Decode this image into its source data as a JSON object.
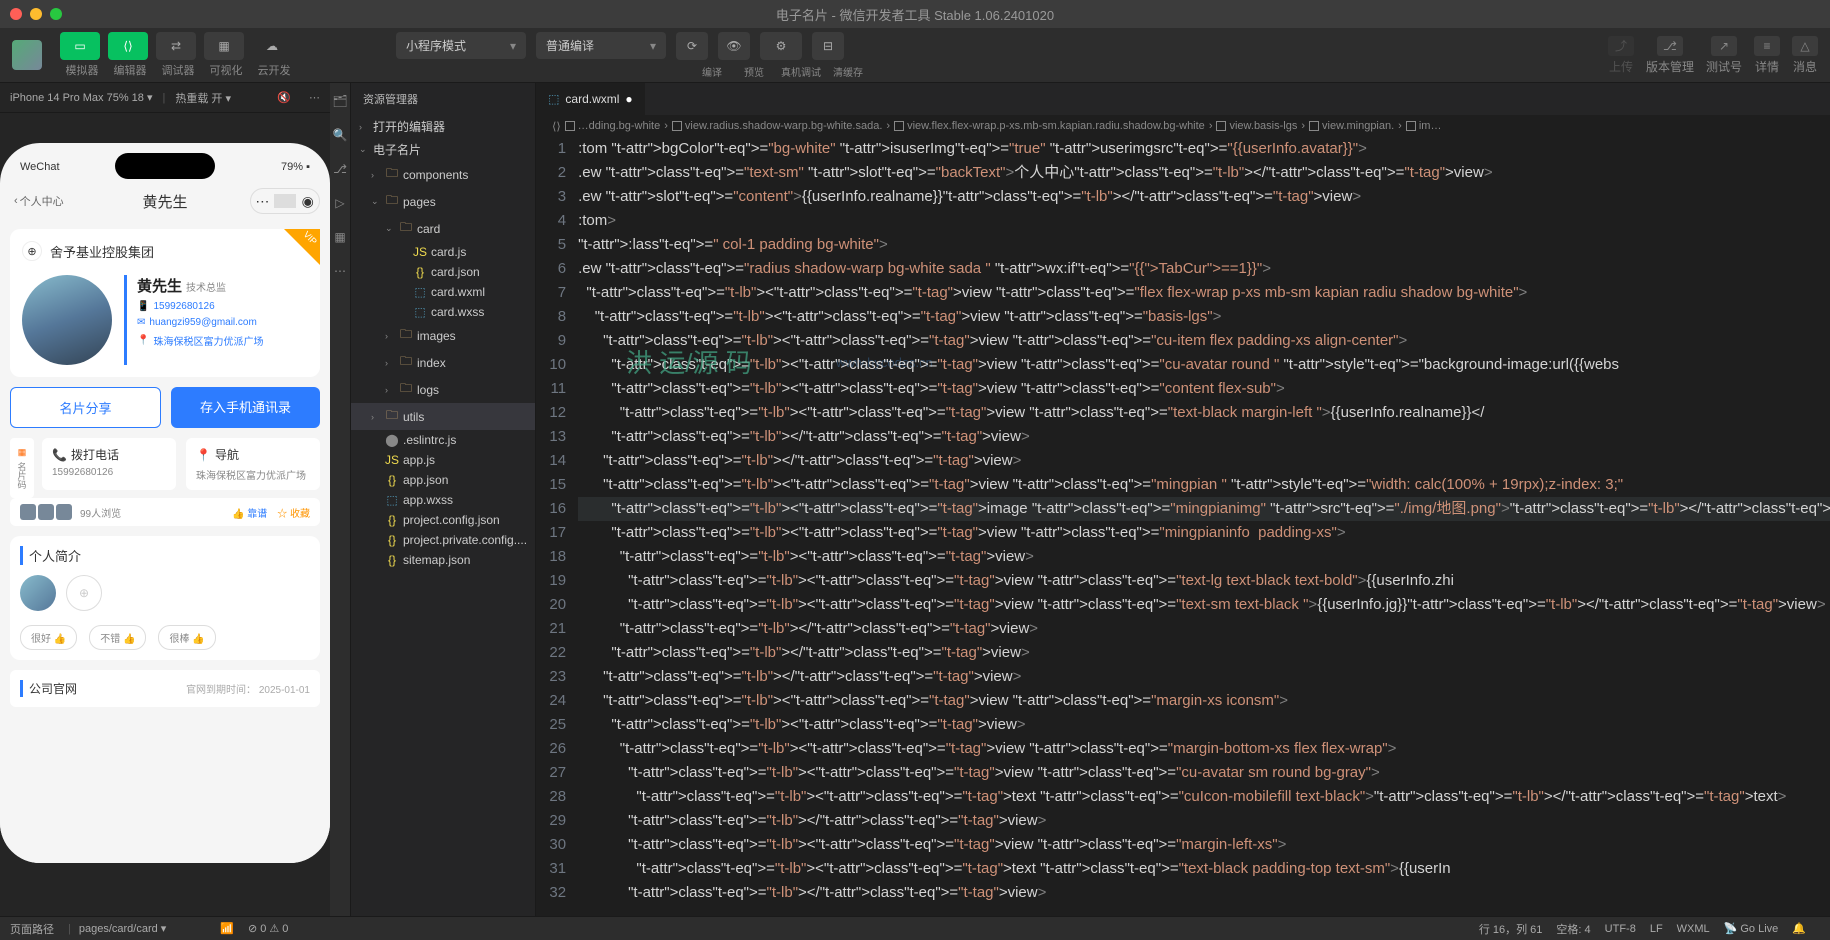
{
  "titlebar": {
    "title": "电子名片 - 微信开发者工具 Stable 1.06.2401020"
  },
  "toolbar": {
    "modes": [
      "模拟器",
      "编辑器",
      "调试器",
      "可视化",
      "云开发"
    ],
    "compile_mode": "小程序模式",
    "compile_type": "普通编译",
    "center_actions": [
      "编译",
      "预览",
      "真机调试",
      "清缓存"
    ],
    "right_actions": [
      "上传",
      "版本管理",
      "测试号",
      "详情",
      "消息"
    ]
  },
  "simbar": {
    "device": "iPhone 14 Pro Max 75% 18",
    "hot": "热重载 开"
  },
  "phone": {
    "status_left": "WeChat",
    "status_right": "79%",
    "back": "个人中心",
    "title": "黄先生",
    "company": "舍予基业控股集团",
    "name": "黄先生",
    "role": "技术总监",
    "phone": "15992680126",
    "email": "huangzi959@gmail.com",
    "address": "珠海保税区富力优派广场",
    "btn_share": "名片分享",
    "btn_save": "存入手机通讯录",
    "act_call": "拨打电话",
    "act_call_sub": "15992680126",
    "act_nav": "导航",
    "act_nav_sub": "珠海保税区富力优派广场",
    "side_label": "名片码",
    "views": "99人浏览",
    "like": "靠谱",
    "fav": "收藏",
    "intro_title": "个人简介",
    "fb1": "很好 👍",
    "fb2": "不错 👍",
    "fb3": "很棒 👍",
    "site_label": "公司官网",
    "site_exp": "官网到期时间： 2025-01-01"
  },
  "explorer": {
    "title": "资源管理器",
    "sections": [
      "打开的编辑器",
      "电子名片"
    ],
    "tree": [
      "components",
      "pages",
      "card",
      "card.js",
      "card.json",
      "card.wxml",
      "card.wxss",
      "images",
      "index",
      "logs",
      "utils",
      ".eslintrc.js",
      "app.js",
      "app.json",
      "app.wxss",
      "project.config.json",
      "project.private.config....",
      "sitemap.json"
    ]
  },
  "tab": {
    "name": "card.wxml"
  },
  "breadcrumb": [
    "…dding.bg-white",
    "view.radius.shadow-warp.bg-white.sada.",
    "view.flex.flex-wrap.p-xs.mb-sm.kapian.radiu.shadow.bg-white",
    "view.basis-lgs",
    "view.mingpian.",
    "im…"
  ],
  "code": {
    "start": 1,
    "lines": [
      ":tom bgColor=\"bg-white\" isuserImg=\"true\" userimgsrc=\"{{userInfo.avatar}}\">",
      ".ew class=\"text-sm\" slot=\"backText\">个人中心</view>",
      ".ew slot=\"content\">{{userInfo.realname}}</view>",
      ":tom>",
      ":lass=\" col-1 padding bg-white\">",
      ".ew class=\"radius shadow-warp bg-white sada \" wx:if=\"{{TabCur==1}}\">",
      "  <view class=\"flex flex-wrap p-xs mb-sm kapian radiu shadow bg-white\">",
      "    <view class=\"basis-lgs\">",
      "      <view class=\"cu-item flex padding-xs align-center\">",
      "        <view class=\"cu-avatar round \" style=\"background-image:url({{webs",
      "        <view class=\"content flex-sub\">",
      "          <view class=\"text-black margin-left \">{{userInfo.realname}}</",
      "        </view>",
      "      </view>",
      "      <view class=\"mingpian \" style=\"width: calc(100% + 19rpx);z-index: 3;\"",
      "        <image class=\"mingpianimg\" src=\"./img/地图.png\"></image>",
      "        <view class=\"mingpianinfo  padding-xs\">",
      "          <view>",
      "            <view class=\"text-lg text-black text-bold\">{{userInfo.zhi",
      "            <view class=\"text-sm text-black \">{{userInfo.jg}}</view>",
      "          </view>",
      "        </view>",
      "      </view>",
      "      <view class=\"margin-xs iconsm\">",
      "        <view>",
      "          <view class=\"margin-bottom-xs flex flex-wrap\">",
      "            <view class=\"cu-avatar sm round bg-gray\">",
      "              <text class=\"cuIcon-mobilefill text-black\"></text>",
      "            </view>",
      "            <view class=\"margin-left-xs\">",
      "              <text class=\"text-black padding-top text-sm\">{{userIn",
      "            </view>"
    ],
    "highlight": 16
  },
  "watermark": "洪 运/源 码",
  "watermark2": "www.hycodes.cn",
  "status": {
    "left1": "页面路径",
    "left2": "pages/card/card",
    "errors": "0",
    "warnings": "0",
    "pos": "行 16，列 61",
    "spaces": "空格: 4",
    "enc": "UTF-8",
    "eol": "LF",
    "lang": "WXML",
    "live": "Go Live"
  }
}
